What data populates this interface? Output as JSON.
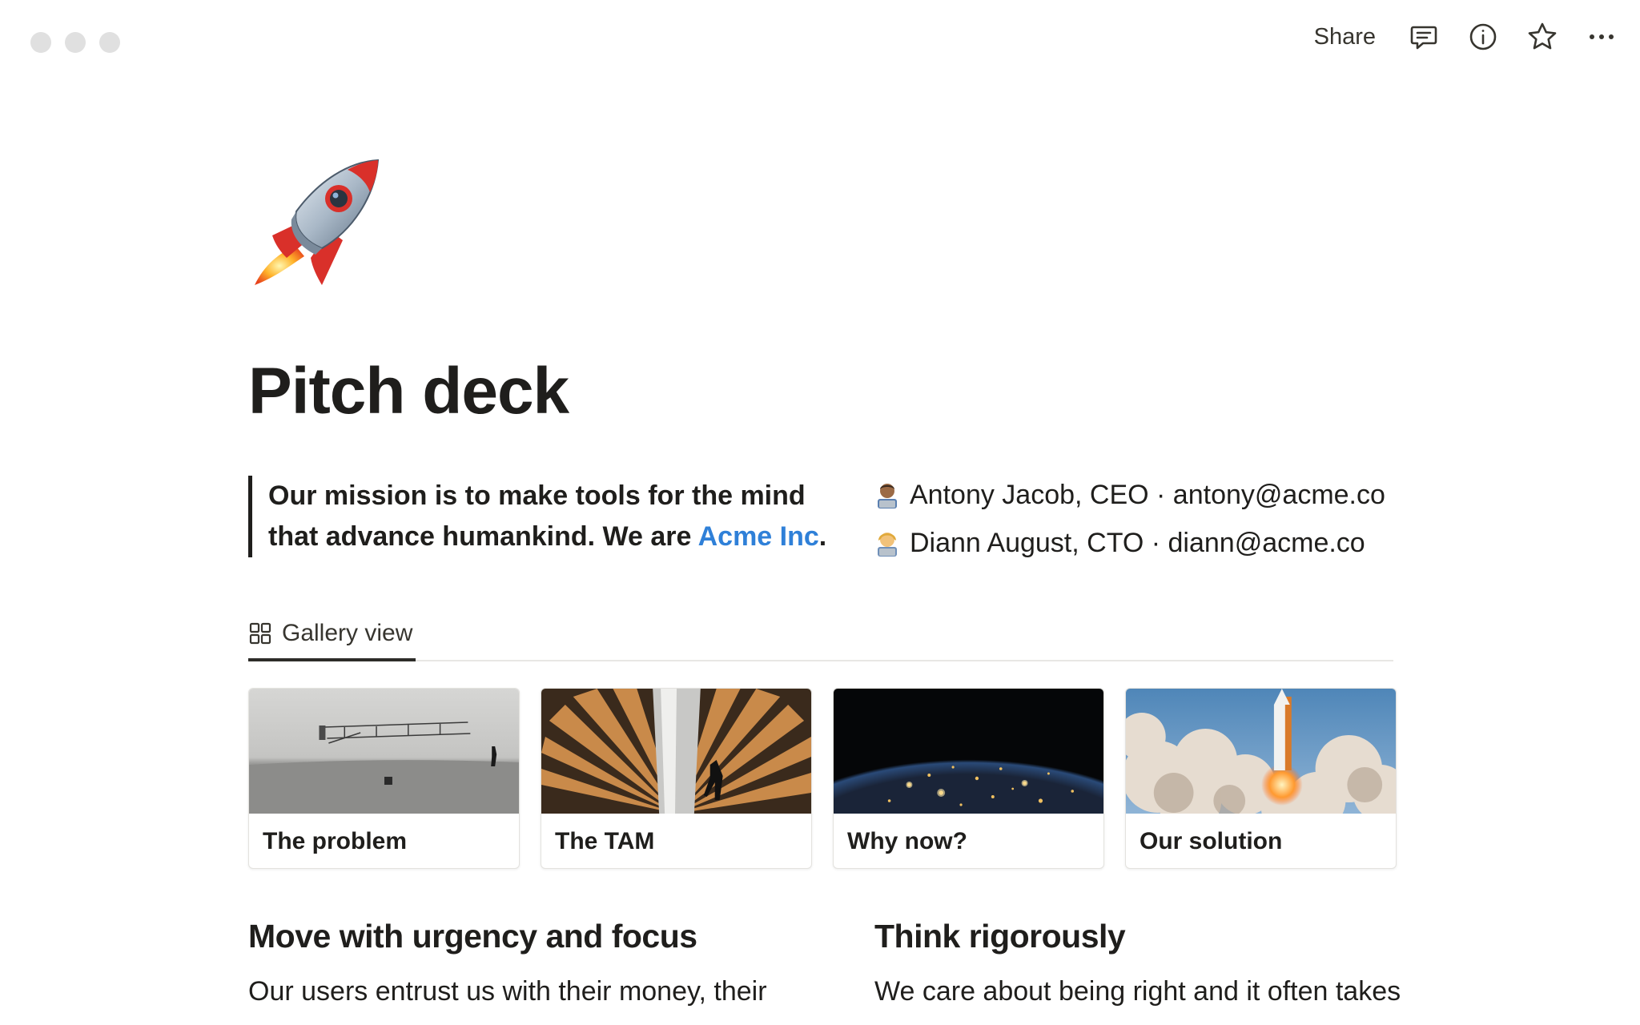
{
  "topbar": {
    "share_label": "Share",
    "icons": [
      "comment-icon",
      "info-icon",
      "star-icon",
      "more-icon"
    ]
  },
  "page": {
    "icon": "rocket-icon",
    "title": "Pitch deck",
    "quote": {
      "text": "Our mission is to make tools for the mind that advance humankind. We are ",
      "link": "Acme Inc",
      "suffix": "."
    },
    "people": [
      {
        "text": "Antony Jacob, CEO · antony@acme.co",
        "avatar": "man-technologist-avatar"
      },
      {
        "text": "Diann August, CTO · diann@acme.co",
        "avatar": "woman-technologist-avatar"
      }
    ]
  },
  "view_tab": {
    "label": "Gallery view",
    "icon": "gallery-icon"
  },
  "gallery": [
    {
      "title": "The problem",
      "cover": "airplane-photo"
    },
    {
      "title": "The TAM",
      "cover": "turbine-photo"
    },
    {
      "title": "Why now?",
      "cover": "earth-night-photo"
    },
    {
      "title": "Our solution",
      "cover": "rocket-launch-photo"
    }
  ],
  "sections": [
    {
      "heading": "Move with urgency and focus",
      "body": "Our users entrust us with their money, their"
    },
    {
      "heading": "Think rigorously",
      "body": "We care about being right and it often takes"
    }
  ],
  "colors": {
    "link": "#2f80d8",
    "text": "#1f1e1c"
  }
}
